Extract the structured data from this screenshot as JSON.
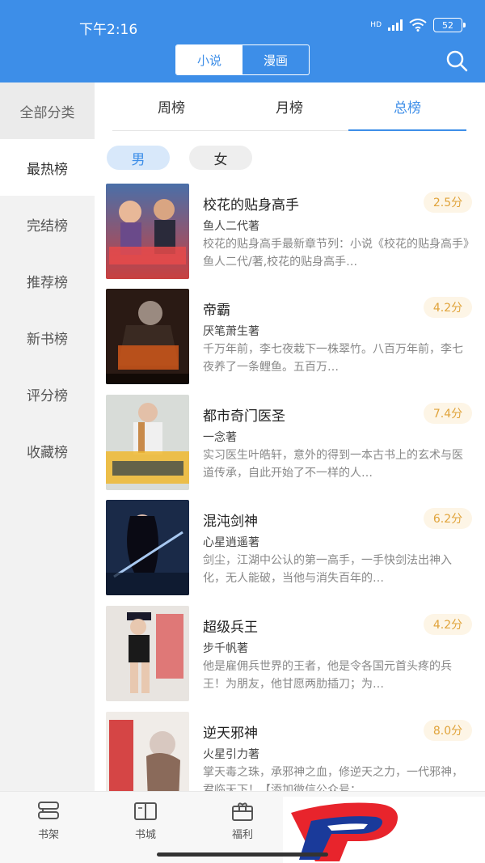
{
  "status": {
    "time": "下午2:16",
    "battery": "52",
    "hd": "HD"
  },
  "header": {
    "segments": [
      "小说",
      "漫画"
    ],
    "active_segment": 0
  },
  "sidebar": {
    "items": [
      "全部分类",
      "最热榜",
      "完结榜",
      "推荐榜",
      "新书榜",
      "评分榜",
      "收藏榜"
    ],
    "active": 1
  },
  "tabs": {
    "items": [
      "周榜",
      "月榜",
      "总榜"
    ],
    "active": 2
  },
  "gender": {
    "male": "男",
    "female": "女"
  },
  "books": [
    {
      "title": "校花的贴身高手",
      "author": "鱼人二代著",
      "score": "2.5分",
      "desc": "校花的贴身高手最新章节列：小说《校花的贴身高手》鱼人二代/著,校花的贴身高手…"
    },
    {
      "title": "帝霸",
      "author": "厌笔萧生著",
      "score": "4.2分",
      "desc": "千万年前，李七夜栽下一株翠竹。八百万年前，李七夜养了一条鲤鱼。五百万…"
    },
    {
      "title": "都市奇门医圣",
      "author": "一念著",
      "score": "7.4分",
      "desc": "实习医生叶皓轩，意外的得到一本古书上的玄术与医道传承，自此开始了不一样的人…"
    },
    {
      "title": "混沌剑神",
      "author": "心星逍遥著",
      "score": "6.2分",
      "desc": "剑尘，江湖中公认的第一高手，一手快剑法出神入化，无人能破，当他与消失百年的…"
    },
    {
      "title": "超级兵王",
      "author": "步千帆著",
      "score": "4.2分",
      "desc": "他是雇佣兵世界的王者，他是令各国元首头疼的兵王！为朋友，他甘愿两肋插刀；为…"
    },
    {
      "title": "逆天邪神",
      "author": "火星引力著",
      "score": "8.0分",
      "desc": "掌天毒之珠，承邪神之血，修逆天之力，一代邪神，君临天下！【添加微信公众号：…"
    }
  ],
  "bottom_nav": {
    "items": [
      "书架",
      "书城",
      "福利"
    ]
  },
  "colors": {
    "primary": "#3d8ee8",
    "score_text": "#e0a33a",
    "score_bg": "#fdf5e6"
  }
}
